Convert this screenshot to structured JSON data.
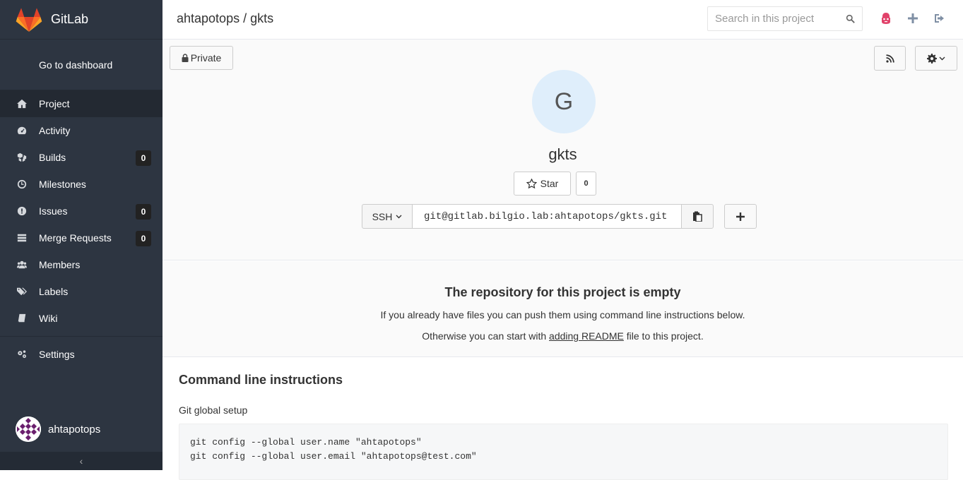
{
  "brand": {
    "name": "GitLab"
  },
  "sidebar": {
    "dashboard_link": "Go to dashboard",
    "items": [
      {
        "label": "Project",
        "icon": "home-icon",
        "active": true
      },
      {
        "label": "Activity",
        "icon": "dashboard-icon"
      },
      {
        "label": "Builds",
        "icon": "cubes-icon",
        "count": "0"
      },
      {
        "label": "Milestones",
        "icon": "clock-icon"
      },
      {
        "label": "Issues",
        "icon": "exclamation-circle-icon",
        "count": "0"
      },
      {
        "label": "Merge Requests",
        "icon": "list-icon",
        "count": "0"
      },
      {
        "label": "Members",
        "icon": "users-icon"
      },
      {
        "label": "Labels",
        "icon": "tags-icon"
      },
      {
        "label": "Wiki",
        "icon": "book-icon"
      }
    ],
    "settings": {
      "label": "Settings",
      "icon": "cogs-icon"
    },
    "user": {
      "name": "ahtapotops"
    },
    "collapse_glyph": "‹"
  },
  "header": {
    "title": "ahtapotops / gkts",
    "search_placeholder": "Search in this project"
  },
  "project": {
    "visibility": "Private",
    "avatar_letter": "G",
    "name": "gkts",
    "star_label": "Star",
    "star_count": "0",
    "clone_protocol": "SSH",
    "clone_url": "git@gitlab.bilgio.lab:ahtapotops/gkts.git"
  },
  "empty": {
    "title": "The repository for this project is empty",
    "line1": "If you already have files you can push them using command line instructions below.",
    "line2_before": "Otherwise you can start with ",
    "line2_link": "adding README",
    "line2_after": " file to this project."
  },
  "commands": {
    "title": "Command line instructions",
    "git_setup_title": "Git global setup",
    "lines": [
      "git config --global user.name \"ahtapotops\"",
      "git config --global user.email \"ahtapotops@test.com\""
    ]
  },
  "colors": {
    "sidebar_bg": "#2d3541",
    "accent_red": "#e24329",
    "avatar_bg": "#dfeefb"
  }
}
